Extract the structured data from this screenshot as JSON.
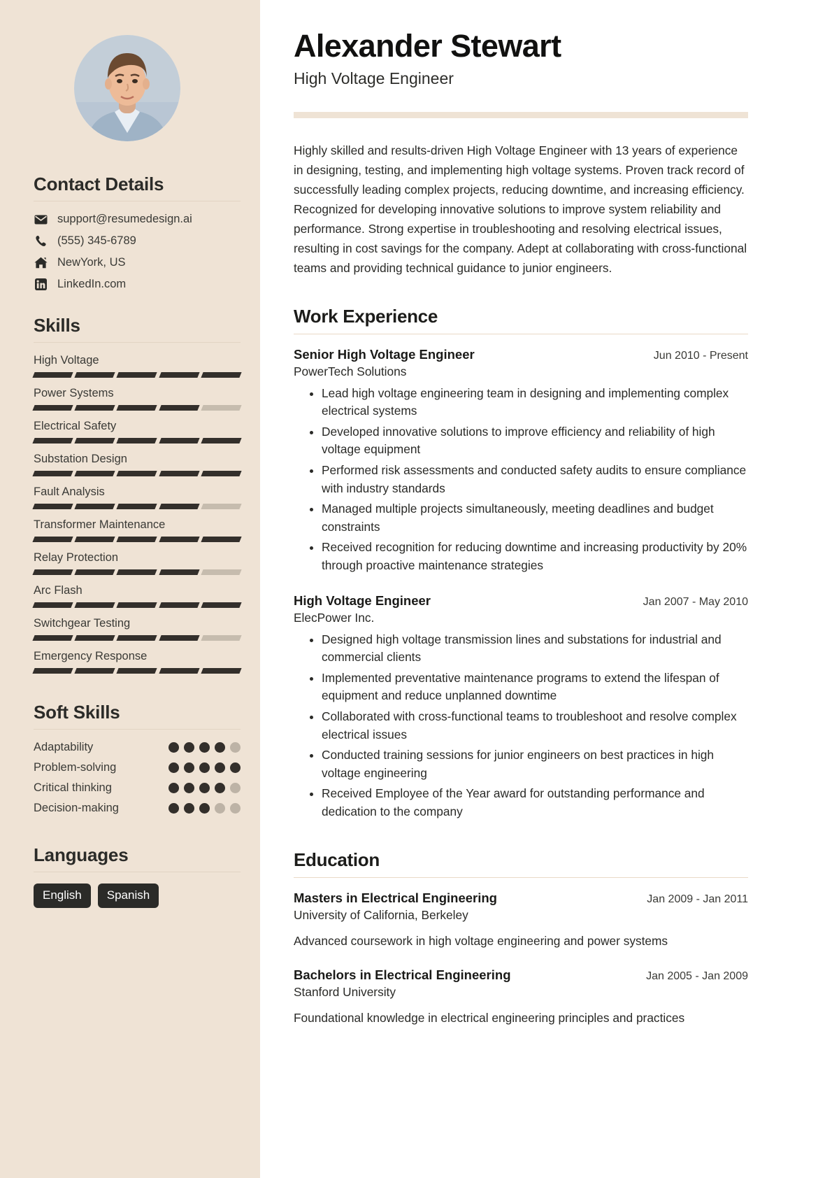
{
  "header": {
    "name": "Alexander Stewart",
    "job_title": "High Voltage Engineer"
  },
  "summary": "Highly skilled and results-driven High Voltage Engineer with 13 years of experience in designing, testing, and implementing high voltage systems. Proven track record of successfully leading complex projects, reducing downtime, and increasing efficiency. Recognized for developing innovative solutions to improve system reliability and performance. Strong expertise in troubleshooting and resolving electrical issues, resulting in cost savings for the company. Adept at collaborating with cross-functional teams and providing technical guidance to junior engineers.",
  "sidebar": {
    "contact_heading": "Contact Details",
    "contact": [
      {
        "icon": "envelope-icon",
        "value": "support@resumedesign.ai"
      },
      {
        "icon": "phone-icon",
        "value": "(555) 345-6789"
      },
      {
        "icon": "home-icon",
        "value": "NewYork, US"
      },
      {
        "icon": "linkedin-icon",
        "value": "LinkedIn.com"
      }
    ],
    "skills_heading": "Skills",
    "skills": [
      {
        "label": "High Voltage",
        "level": 5,
        "max": 5
      },
      {
        "label": "Power Systems",
        "level": 4,
        "max": 5
      },
      {
        "label": "Electrical Safety",
        "level": 5,
        "max": 5
      },
      {
        "label": "Substation Design",
        "level": 5,
        "max": 5
      },
      {
        "label": "Fault Analysis",
        "level": 4,
        "max": 5
      },
      {
        "label": "Transformer Maintenance",
        "level": 5,
        "max": 5
      },
      {
        "label": "Relay Protection",
        "level": 4,
        "max": 5
      },
      {
        "label": "Arc Flash",
        "level": 5,
        "max": 5
      },
      {
        "label": "Switchgear Testing",
        "level": 4,
        "max": 5
      },
      {
        "label": "Emergency Response",
        "level": 5,
        "max": 5
      }
    ],
    "soft_skills_heading": "Soft Skills",
    "soft_skills": [
      {
        "label": "Adaptability",
        "level": 4,
        "max": 5
      },
      {
        "label": "Problem-solving",
        "level": 5,
        "max": 5
      },
      {
        "label": "Critical thinking",
        "level": 4,
        "max": 5
      },
      {
        "label": "Decision-making",
        "level": 3,
        "max": 5
      }
    ],
    "languages_heading": "Languages",
    "languages": [
      "English",
      "Spanish"
    ]
  },
  "work": {
    "heading": "Work Experience",
    "entries": [
      {
        "role": "Senior High Voltage Engineer",
        "date": "Jun 2010 - Present",
        "org": "PowerTech Solutions",
        "bullets": [
          "Lead high voltage engineering team in designing and implementing complex electrical systems",
          "Developed innovative solutions to improve efficiency and reliability of high voltage equipment",
          "Performed risk assessments and conducted safety audits to ensure compliance with industry standards",
          "Managed multiple projects simultaneously, meeting deadlines and budget constraints",
          "Received recognition for reducing downtime and increasing productivity by 20% through proactive maintenance strategies"
        ]
      },
      {
        "role": "High Voltage Engineer",
        "date": "Jan 2007 - May 2010",
        "org": "ElecPower Inc.",
        "bullets": [
          "Designed high voltage transmission lines and substations for industrial and commercial clients",
          "Implemented preventative maintenance programs to extend the lifespan of equipment and reduce unplanned downtime",
          "Collaborated with cross-functional teams to troubleshoot and resolve complex electrical issues",
          "Conducted training sessions for junior engineers on best practices in high voltage engineering",
          "Received Employee of the Year award for outstanding performance and dedication to the company"
        ]
      }
    ]
  },
  "education": {
    "heading": "Education",
    "entries": [
      {
        "degree": "Masters in Electrical Engineering",
        "date": "Jan 2009 - Jan 2011",
        "school": "University of California, Berkeley",
        "description": "Advanced coursework in high voltage engineering and power systems"
      },
      {
        "degree": "Bachelors in Electrical Engineering",
        "date": "Jan 2005 - Jan 2009",
        "school": "Stanford University",
        "description": "Foundational knowledge in electrical engineering principles and practices"
      }
    ]
  },
  "colors": {
    "sidebar_bg": "#EFE3D5",
    "accent_rule": "#EFE3D5",
    "ink": "#2b2b28",
    "bar_on": "#332f2b",
    "bar_off": "#c6bcae",
    "tag_bg": "#2b2b28"
  }
}
